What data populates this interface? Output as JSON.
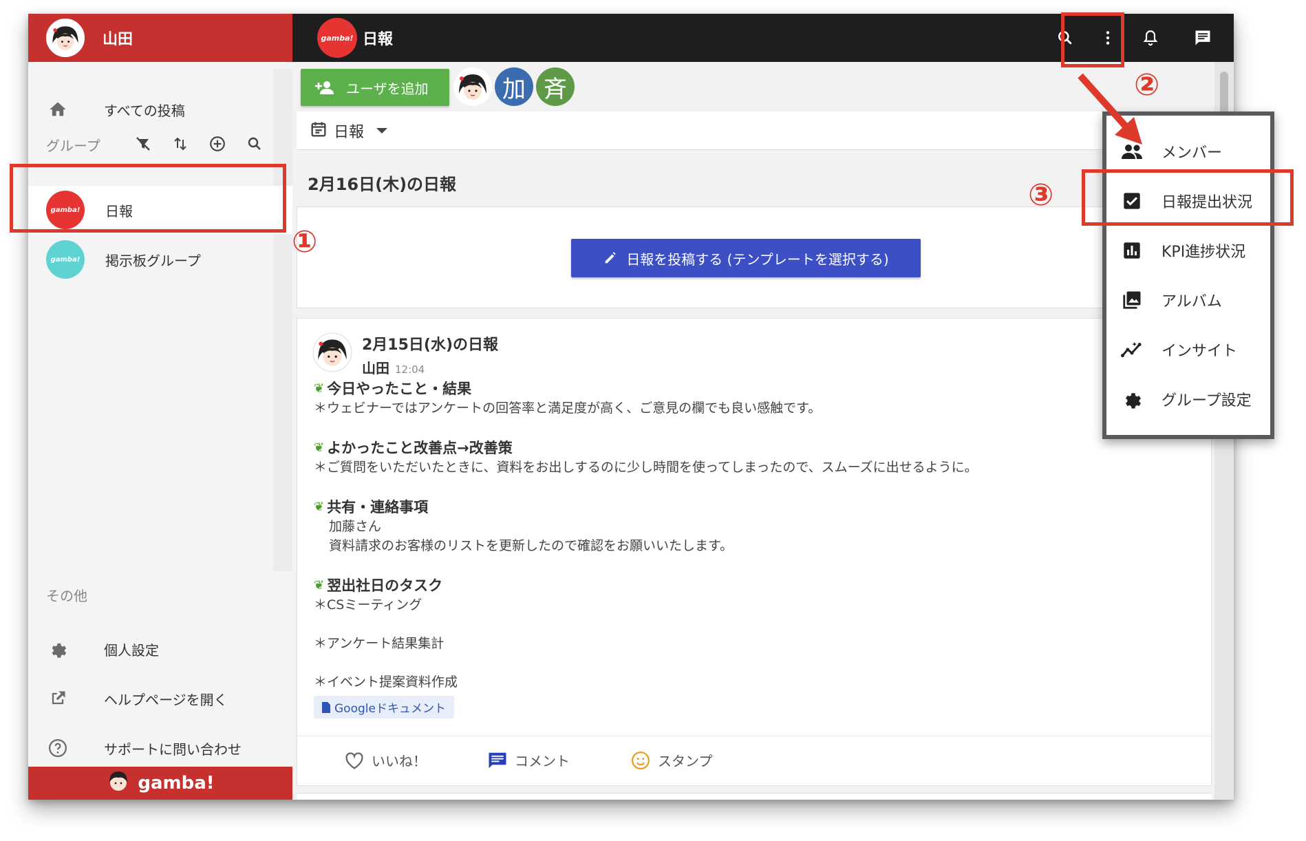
{
  "sidebar": {
    "user_name": "山田",
    "all_posts": "すべての投稿",
    "groups_label": "グループ",
    "groups": [
      {
        "name": "日報",
        "logo": "gamba!",
        "color": "#e53431"
      },
      {
        "name": "掲示板グループ",
        "logo": "gamba!",
        "color": "#5fd3d2"
      }
    ],
    "other_label": "その他",
    "other_items": [
      {
        "label": "個人設定",
        "icon": "gear-icon"
      },
      {
        "label": "ヘルプページを開く",
        "icon": "external-link-icon"
      },
      {
        "label": "サポートに問い合わせ",
        "icon": "help-circle-icon"
      }
    ],
    "footer_brand": "gamba!"
  },
  "topbar": {
    "logo": "gamba!",
    "title": "日報"
  },
  "main": {
    "add_user": "ユーザを追加",
    "member_chars": [
      "加",
      "斉"
    ],
    "selected_group": "日報",
    "today_heading": "2月16日(木)の日報",
    "post_button": "日報を投稿する (テンプレートを選択する)",
    "report": {
      "title": "2月15日(水)の日報",
      "author": "山田",
      "time": "12:04",
      "sections": [
        {
          "title": "今日やったこと・結果",
          "lines": [
            "＊ウェビナーではアンケートの回答率と満足度が高く、ご意見の欄でも良い感触です。"
          ]
        },
        {
          "title": "よかったこと改善点→改善策",
          "lines": [
            "＊ご質問をいただいたときに、資料をお出しするのに少し時間を使ってしまったので、スムーズに出せるように。"
          ]
        },
        {
          "title": "共有・連絡事項",
          "lines": [
            "加藤さん",
            "資料請求のお客様のリストを更新したので確認をお願いいたします。"
          ]
        },
        {
          "title": "翌出社日のタスク",
          "lines": [
            "＊CSミーティング",
            "",
            "＊アンケート結果集計",
            "",
            "＊イベント提案資料作成"
          ]
        }
      ],
      "attachment": "Googleドキュメント",
      "actions": [
        "いいね！",
        "コメント",
        "スタンプ"
      ]
    }
  },
  "menu": {
    "items": [
      {
        "label": "メンバー",
        "icon": "group-icon"
      },
      {
        "label": "日報提出状況",
        "icon": "checkbox-icon"
      },
      {
        "label": "KPI進捗状況",
        "icon": "bar-chart-icon"
      },
      {
        "label": "アルバム",
        "icon": "photo-album-icon"
      },
      {
        "label": "インサイト",
        "icon": "insights-icon"
      },
      {
        "label": "グループ設定",
        "icon": "gear-icon"
      }
    ]
  },
  "annotations": [
    "①",
    "②",
    "③"
  ],
  "colors": {
    "brand_red": "#c6302f",
    "annotation_red": "#de3a2c",
    "add_user_green": "#5db14c",
    "post_button_blue": "#3c4fc4",
    "topbar_dark": "#1e1e1e"
  }
}
